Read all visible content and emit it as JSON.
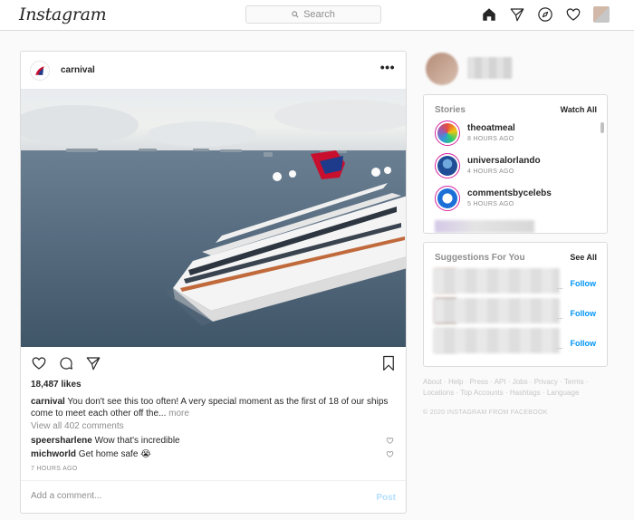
{
  "nav": {
    "logo": "Instagram",
    "search_placeholder": "Search",
    "icons": [
      "home-icon",
      "direct-icon",
      "explore-icon",
      "heart-icon",
      "profile-avatar"
    ]
  },
  "post": {
    "username": "carnival",
    "more": "•••",
    "likes": "18,487 likes",
    "caption_user": "carnival",
    "caption_text": "You don't see this too often! A very special moment as the first of 18 of our ships come to meet each other off the...",
    "caption_more": "more",
    "view_all": "View all 402 comments",
    "comments": [
      {
        "user": "speersharlene",
        "text": "Wow that's incredible"
      },
      {
        "user": "michworld",
        "text": "Get home safe 😭"
      }
    ],
    "time_ago": "7 HOURS AGO",
    "add_comment_placeholder": "Add a comment...",
    "post_button": "Post"
  },
  "stories": {
    "title": "Stories",
    "link": "Watch All",
    "items": [
      {
        "name": "theoatmeal",
        "time": "8 HOURS AGO"
      },
      {
        "name": "universalorlando",
        "time": "4 HOURS AGO"
      },
      {
        "name": "commentsbycelebs",
        "time": "5 HOURS AGO"
      }
    ]
  },
  "suggestions": {
    "title": "Suggestions For You",
    "link": "See All",
    "follow_labels": [
      "Follow",
      "Follow",
      "Follow"
    ],
    "ellipsis": "..."
  },
  "footer": {
    "links": "About · Help · Press · API · Jobs · Privacy · Terms · Locations · Top Accounts · Hashtags · Language",
    "copyright": "© 2020 INSTAGRAM FROM FACEBOOK"
  },
  "colors": {
    "accent": "#0095f6",
    "post_disabled": "#b2dffc",
    "border": "#dbdbdb",
    "muted": "#8e8e8e"
  }
}
